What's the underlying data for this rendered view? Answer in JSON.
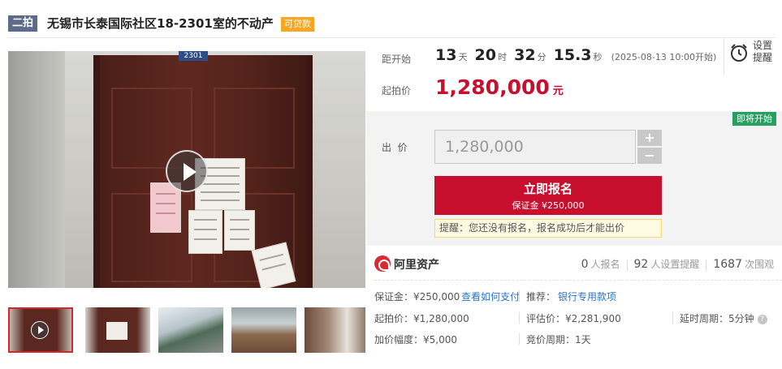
{
  "header": {
    "round_tag": "二拍",
    "title": "无锡市长泰国际社区18-2301室的不动产",
    "loan_badge": "可贷款"
  },
  "gallery": {
    "door_number": "2301",
    "thumbnail_count": 5,
    "active_thumbnail": 0
  },
  "auction": {
    "countdown_label": "距开始",
    "countdown": {
      "days": "13",
      "days_unit": "天",
      "hours": "20",
      "hours_unit": "时",
      "minutes": "32",
      "minutes_unit": "分",
      "seconds": "15.3",
      "seconds_unit": "秒",
      "start_time": "(2025-08-13 10:00开始)"
    },
    "remind_label": "设置提醒",
    "start_price_label": "起拍价",
    "start_price": "1,280,000",
    "currency_unit": "元"
  },
  "bid": {
    "status_tag": "即将开始",
    "bid_label": "出  价",
    "bid_value": "1,280,000",
    "plus": "+",
    "minus": "−",
    "register_button": "立即报名",
    "deposit_line": "保证金 ¥250,000",
    "tip": "提醒：您还没有报名，报名成功后才能出价"
  },
  "platform": {
    "brand": "阿里资产",
    "stats": [
      {
        "value": "0",
        "label": "人报名"
      },
      {
        "value": "92",
        "label": "人设置提醒"
      },
      {
        "value": "1687",
        "label": "次围观"
      }
    ]
  },
  "details": {
    "deposit": "保证金：¥250,000",
    "how_to_pay": "查看如何支付",
    "recommend_label": "推荐：",
    "recommend_link": "银行专用款项",
    "start_price": "起拍价：¥1,280,000",
    "appraisal": "评估价：¥2,281,900",
    "extension": "延时周期：5分钟",
    "increment": "加价幅度：¥5,000",
    "bid_cycle": "竞价周期：1天"
  },
  "colors": {
    "accent_red": "#c8102e",
    "badge_orange": "#f5a623",
    "status_green": "#26a05e",
    "link_blue": "#2b74c9"
  }
}
